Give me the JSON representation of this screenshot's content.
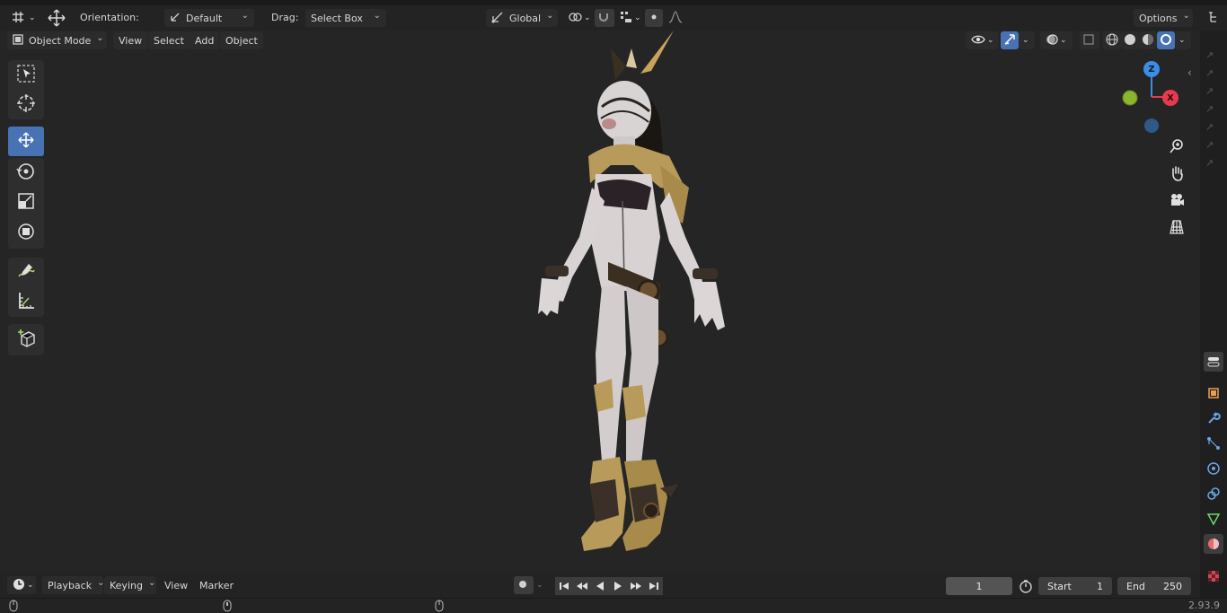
{
  "header": {
    "orientation_label": "Orientation:",
    "orientation_value": "Default",
    "drag_label": "Drag:",
    "drag_value": "Select Box",
    "transform_space": "Global",
    "options_label": "Options"
  },
  "viewport_menu": {
    "mode": "Object Mode",
    "view": "View",
    "select": "Select",
    "add": "Add",
    "object": "Object"
  },
  "gizmo": {
    "z_label": "Z",
    "x_label": "X",
    "colors": {
      "x": "#e83a4f",
      "y": "#8ab52f",
      "z": "#3a8ee6",
      "neg_z": "#2e5a8a"
    }
  },
  "tools": [
    "select-box",
    "cursor",
    "move",
    "rotate",
    "scale",
    "transform",
    "annotate",
    "measure",
    "add-cube"
  ],
  "timeline": {
    "playback": "Playback",
    "keying": "Keying",
    "view": "View",
    "marker": "Marker",
    "current_frame": "1",
    "start_label": "Start",
    "start_value": "1",
    "end_label": "End",
    "end_value": "250"
  },
  "status": {
    "version": "2.93.9"
  },
  "colors": {
    "accent": "#4772b3",
    "bg": "#1d1d1d",
    "viewport": "#252525"
  }
}
